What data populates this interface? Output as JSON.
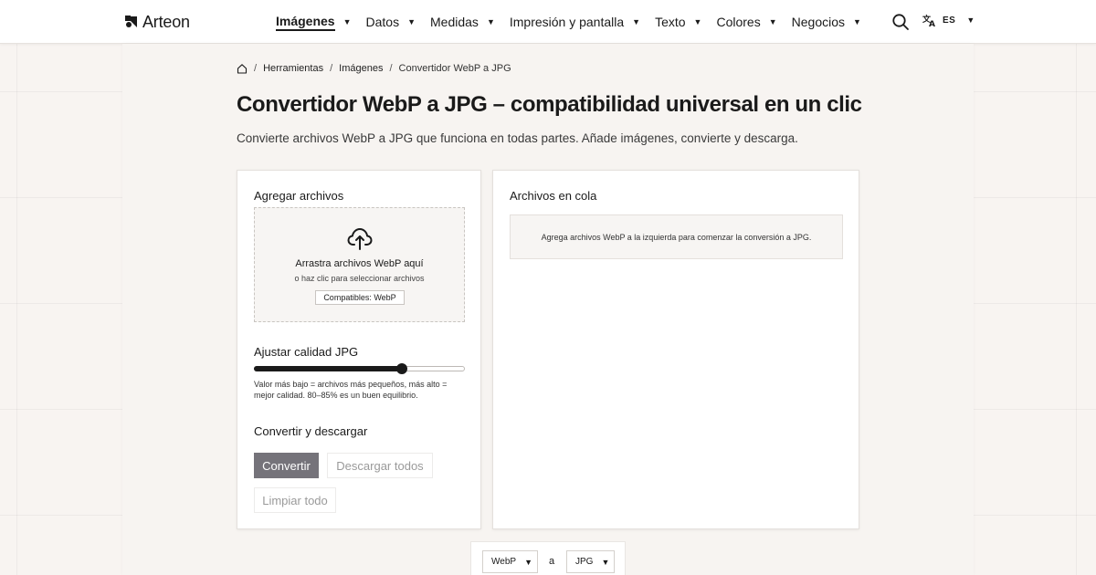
{
  "header": {
    "brand": "Arteon",
    "nav": [
      {
        "label": "Imágenes",
        "active": true
      },
      {
        "label": "Datos",
        "active": false
      },
      {
        "label": "Medidas",
        "active": false
      },
      {
        "label": "Impresión y pantalla",
        "active": false
      },
      {
        "label": "Texto",
        "active": false
      },
      {
        "label": "Colores",
        "active": false
      },
      {
        "label": "Negocios",
        "active": false
      }
    ],
    "caret": "▼",
    "search_icon": "search-icon",
    "lang_icon": "translate-icon",
    "lang_code": "ES"
  },
  "breadcrumb": {
    "home_icon": "home-icon",
    "separator": "/",
    "items": [
      "Herramientas",
      "Imágenes"
    ],
    "current": "Convertidor WebP a JPG"
  },
  "page": {
    "title": "Convertidor WebP a JPG – compatibilidad universal en un clic",
    "subtitle": "Convierte archivos WebP a JPG que funciona en todas partes. Añade imágenes, convierte y descarga."
  },
  "add_files": {
    "heading": "Agregar archivos",
    "dropzone_icon": "cloud-upload-icon",
    "dropzone_title": "Arrastra archivos WebP aquí",
    "dropzone_sub": "o haz clic para seleccionar archivos",
    "dropzone_badge": "Compatibles: WebP"
  },
  "quality": {
    "heading": "Ajustar calidad JPG",
    "value_fraction": 0.7,
    "hint": "Valor más bajo = archivos más pequeños, más alto = mejor calidad. 80–85% es un buen equilibrio."
  },
  "convert": {
    "heading": "Convertir y descargar",
    "convert_label": "Convertir",
    "download_all_label": "Descargar todos",
    "clear_label": "Limpiar todo"
  },
  "queue": {
    "heading": "Archivos en cola",
    "empty_text": "Agrega archivos WebP a la izquierda para comenzar la conversión a JPG."
  },
  "format_selector": {
    "from": "WebP",
    "connector": "a",
    "to": "JPG"
  },
  "colors": {
    "background": "#f8f4f1",
    "primary_button": "#75737a",
    "text": "#1a1a1a"
  }
}
